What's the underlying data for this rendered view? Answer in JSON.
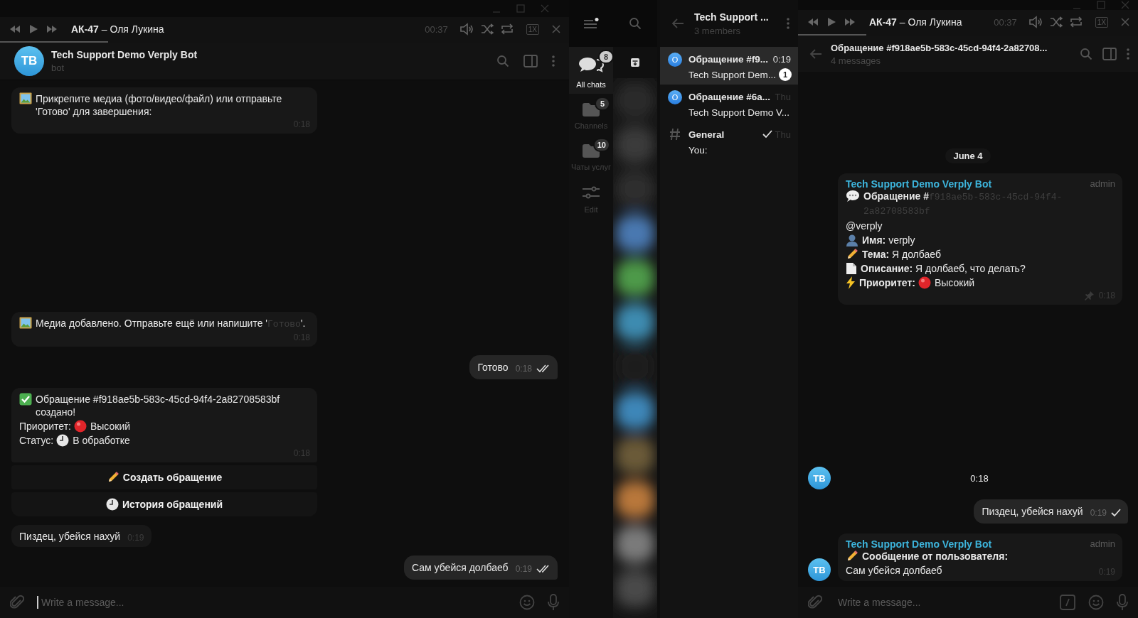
{
  "left_window": {
    "player": {
      "title": "**АК-47** – Оля Лукина",
      "time": "00:37",
      "speed": "1X",
      "level": 0.19
    },
    "chat_header": {
      "avatar": "TB",
      "name": "Tech Support Demo Verply Bot",
      "status": "bot"
    },
    "messages": [
      {
        "kind": "incoming",
        "lines": [
          [
            {
              "kind": "picture"
            },
            {
              "kind": "text",
              "text": "Прикрепите медиа (фото/видео/файл) или отправьте 'Готово' для завершения:"
            }
          ]
        ],
        "time": "0:18"
      },
      {
        "kind": "incoming",
        "lines": [
          [
            {
              "kind": "picture"
            },
            {
              "kind": "text",
              "text": "Медиа добавлено. Отправьте ещё или напишите '"
            },
            {
              "kind": "code",
              "text": "Готово"
            },
            {
              "kind": "text",
              "text": "'."
            }
          ]
        ],
        "time": "0:18"
      },
      {
        "kind": "outgoing",
        "lines": [
          [
            {
              "kind": "text",
              "text": "Готово"
            }
          ]
        ],
        "time": "0:18",
        "read": true
      },
      {
        "kind": "incoming",
        "lines": [
          [
            {
              "kind": "checkmark"
            },
            {
              "kind": "text",
              "text": "Обращение #f918ae5b-583c-45cd-94f4-2a82708583bf создано!"
            }
          ],
          [
            {
              "kind": "text",
              "text": "Приоритет:"
            },
            {
              "kind": "dot"
            },
            {
              "kind": "text",
              "text": "Высокий"
            }
          ],
          [
            {
              "kind": "text",
              "text": "Статус:"
            },
            {
              "kind": "clock"
            },
            {
              "kind": "text",
              "text": "В обработке"
            }
          ]
        ],
        "time": "0:18",
        "buttons": [
          {
            "kind": "pencil",
            "label": "Создать обращение"
          },
          {
            "kind": "clock",
            "label": "История обращений"
          }
        ]
      },
      {
        "kind": "incoming",
        "lines": [
          [
            {
              "kind": "text",
              "text": "Пиздец, убейся нахуй"
            }
          ]
        ],
        "time": "0:19"
      },
      {
        "kind": "outgoing",
        "lines": [
          [
            {
              "kind": "text",
              "text": "Сам убейся долбаеб"
            }
          ]
        ],
        "time": "0:19",
        "read": true
      }
    ],
    "composer": {
      "placeholder": "Write a message..."
    }
  },
  "folders": [
    {
      "kind": "chats",
      "label": "All chats",
      "badge": "8",
      "selected": true
    },
    {
      "kind": "folder",
      "label": "Channels",
      "badge": "5",
      "selected": false
    },
    {
      "kind": "folder",
      "label": "Чаты услуг",
      "badge": "10",
      "selected": false
    },
    {
      "kind": "edit",
      "label": "Edit",
      "selected": false
    }
  ],
  "chat_list": {
    "title": "Tech Support ...",
    "subtitle": "3 members",
    "items": [
      {
        "kind": "letter",
        "avatar": "O",
        "title": "Обращение #f9...",
        "time": "0:19",
        "preview": "Tech Support Dem...",
        "unread": "1",
        "sent": false,
        "selected": true
      },
      {
        "kind": "letter",
        "avatar": "O",
        "title": "Обращение #6a...",
        "time": "Thu",
        "preview": "Tech Support Demo V...",
        "sent": false,
        "selected": false
      },
      {
        "kind": "hash",
        "title": "General",
        "time": "Thu",
        "preview": "You:",
        "sent": true,
        "selected": false
      }
    ]
  },
  "right_window": {
    "player": {
      "title": "**АК-47** – Оля Лукина",
      "time": "00:37",
      "speed": "1X",
      "level": 0.2
    },
    "chat_header": {
      "title": "Обращение #f918ae5b-583c-45cd-94f4-2a82708...",
      "subtitle": "4 messages"
    },
    "messages": [
      {
        "kind": "date",
        "text": "June 4"
      },
      {
        "kind": "incoming",
        "sender": "Tech Support Demo Verply Bot",
        "role": "admin",
        "lines": [
          [
            {
              "kind": "speech"
            },
            {
              "kind": "text",
              "text": "**Обращение #**"
            },
            {
              "kind": "code",
              "text": "f918ae5b-583c-45cd-94f4-2a82708583bf"
            }
          ],
          [
            {
              "kind": "text",
              "text": "@verply"
            }
          ],
          [
            {
              "kind": "person"
            },
            {
              "kind": "text",
              "text": "**Имя:** verply"
            }
          ],
          [
            {
              "kind": "pencil"
            },
            {
              "kind": "text",
              "text": "**Тема:** Я долбаеб"
            }
          ],
          [
            {
              "kind": "document"
            },
            {
              "kind": "text",
              "text": "**Описание:** Я долбаеб, что делать?"
            }
          ],
          [
            {
              "kind": "lightning"
            },
            {
              "kind": "text",
              "text": "**Приоритет:**"
            },
            {
              "kind": "dot"
            },
            {
              "kind": "text",
              "text": "Высокий"
            }
          ]
        ],
        "pinned": true,
        "time": "0:18"
      },
      {
        "kind": "stub",
        "avatar": "TB",
        "time": "0:18"
      },
      {
        "kind": "outgoing",
        "lines": [
          [
            {
              "kind": "text",
              "text": "Пиздец, убейся нахуй"
            }
          ]
        ],
        "time": "0:19",
        "read": false
      },
      {
        "kind": "incoming",
        "avatar": "TB",
        "sender": "Tech Support Demo Verply Bot",
        "role": "admin",
        "lines": [
          [
            {
              "kind": "pencil"
            },
            {
              "kind": "text",
              "text": "**Сообщение от пользователя:**"
            }
          ],
          [
            {
              "kind": "text",
              "text": "Сам убейся долбаеб"
            }
          ]
        ],
        "time": "0:19"
      }
    ],
    "composer": {
      "placeholder": "Write a message..."
    }
  }
}
